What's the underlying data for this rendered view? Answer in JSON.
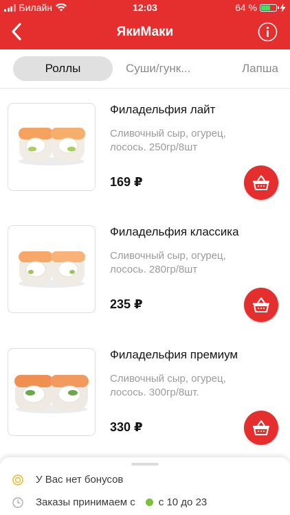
{
  "status": {
    "carrier": "Билайн",
    "time": "12:03",
    "battery_text": "64 %",
    "battery_level": 0.64
  },
  "header": {
    "title": "ЯкиМаки"
  },
  "tabs": [
    {
      "label": "Роллы",
      "active": true
    },
    {
      "label": "Суши/гунк..."
    },
    {
      "label": "Лапша"
    }
  ],
  "products": [
    {
      "name": "Филадельфия лайт",
      "desc1": "Сливочный сыр, огурец,",
      "desc2": "лосось. 250гр/8шт",
      "price": "169 ₽"
    },
    {
      "name": "Филадельфия классика",
      "desc1": "Сливочный сыр, огурец,",
      "desc2": "лосось. 280гр/8шт",
      "price": "235 ₽"
    },
    {
      "name": "Филадельфия премиум",
      "desc1": "Сливочный сыр, огурец,",
      "desc2": "лосось. 300гр/8шт.",
      "price": "330 ₽"
    }
  ],
  "info_panel": {
    "bonus_text": "У Вас нет бонусов",
    "orders_text": "Заказы принимаем с",
    "hours": "с 10 до 23"
  },
  "colors": {
    "brand_red": "#e52e2e",
    "open_green": "#7cc03a",
    "battery_green": "#4cd964"
  },
  "icons": [
    "back-chevron-icon",
    "info-icon",
    "basket-icon",
    "coin-icon",
    "clock-icon",
    "wifi-icon",
    "signal-icon",
    "battery-icon",
    "charging-bolt-icon"
  ]
}
